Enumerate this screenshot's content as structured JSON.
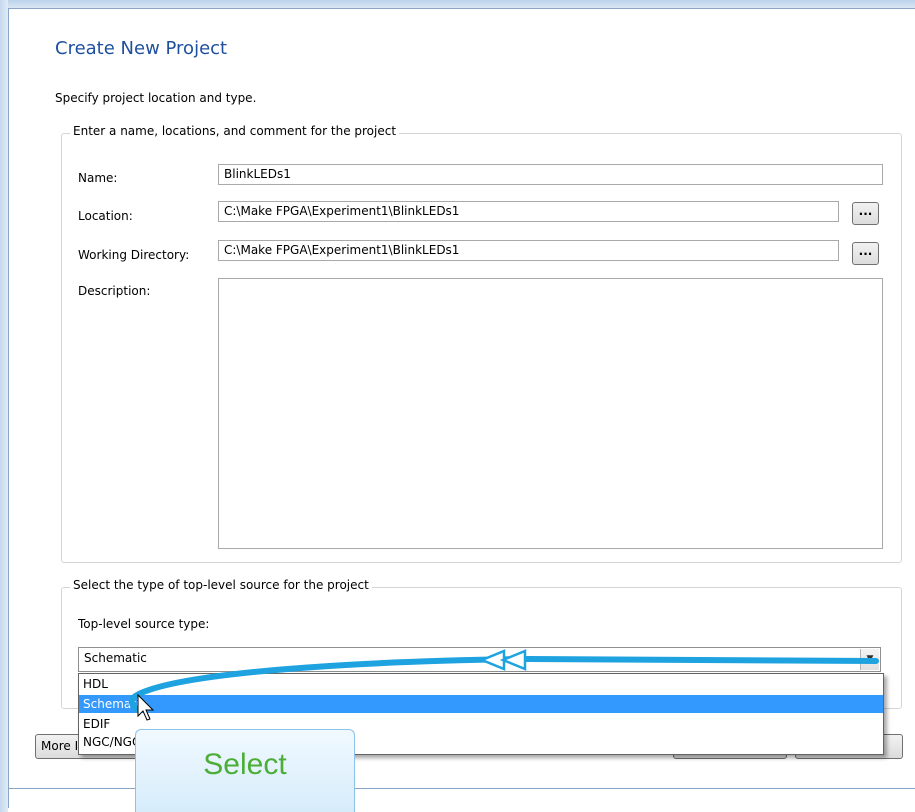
{
  "dialog": {
    "title": "Create New Project",
    "subtitle": "Specify project location and type."
  },
  "project_group": {
    "legend": "Enter a name, locations, and comment for the project",
    "name_label": "Name:",
    "name_value": "BlinkLEDs1",
    "location_label": "Location:",
    "location_value": "C:\\Make FPGA\\Experiment1\\BlinkLEDs1",
    "working_dir_label": "Working Directory:",
    "working_dir_value": "C:\\Make FPGA\\Experiment1\\BlinkLEDs1",
    "description_label": "Description:",
    "description_value": "",
    "browse_label": "..."
  },
  "source_group": {
    "legend": "Select the type of top-level source for the project",
    "type_label": "Top-level source type:",
    "selected_value": "Schematic",
    "options": [
      "HDL",
      "Schematic",
      "EDIF",
      "NGC/NGO"
    ]
  },
  "footer": {
    "more_info_label": "More Info"
  },
  "callout": {
    "text": "Select"
  },
  "colors": {
    "title": "#1e4f9f",
    "selection": "#3399ff",
    "annotation_arrow": "#1fa3e0",
    "callout_text": "#4cae37"
  }
}
